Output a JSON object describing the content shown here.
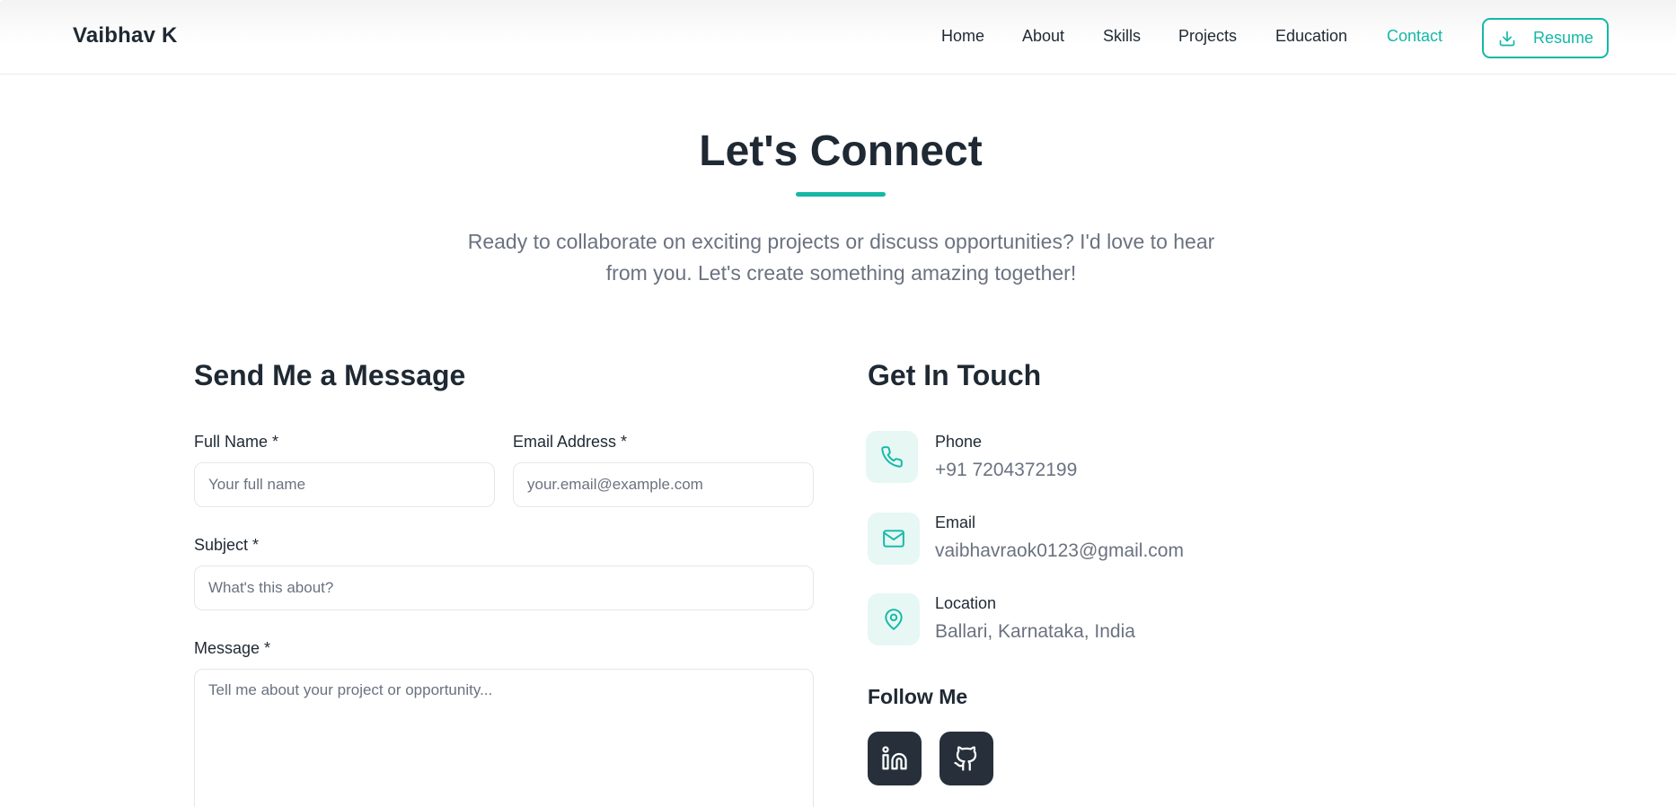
{
  "header": {
    "brand": "Vaibhav K",
    "nav": [
      {
        "label": "Home",
        "active": false
      },
      {
        "label": "About",
        "active": false
      },
      {
        "label": "Skills",
        "active": false
      },
      {
        "label": "Projects",
        "active": false
      },
      {
        "label": "Education",
        "active": false
      },
      {
        "label": "Contact",
        "active": true
      }
    ],
    "resume_label": "Resume",
    "resume_icon": "download-icon"
  },
  "hero": {
    "title": "Let's Connect",
    "subtitle": "Ready to collaborate on exciting projects or discuss opportunities? I'd love to hear from you. Let's create something amazing together!"
  },
  "form": {
    "title": "Send Me a Message",
    "full_name": {
      "label": "Full Name *",
      "placeholder": "Your full name",
      "value": ""
    },
    "email": {
      "label": "Email Address *",
      "placeholder": "your.email@example.com",
      "value": ""
    },
    "subject": {
      "label": "Subject *",
      "placeholder": "What's this about?",
      "value": ""
    },
    "message": {
      "label": "Message *",
      "placeholder": "Tell me about your project or opportunity...",
      "value": ""
    }
  },
  "contact": {
    "title": "Get In Touch",
    "items": [
      {
        "label": "Phone",
        "value": "+91 7204372199",
        "icon": "phone-icon"
      },
      {
        "label": "Email",
        "value": "vaibhavraok0123@gmail.com",
        "icon": "mail-icon"
      },
      {
        "label": "Location",
        "value": "Ballari, Karnataka, India",
        "icon": "map-pin-icon"
      }
    ],
    "follow_title": "Follow Me",
    "socials": [
      {
        "name": "linkedin-icon"
      },
      {
        "name": "github-icon"
      }
    ]
  },
  "colors": {
    "accent": "#14b8a6",
    "text_dark": "#1f2933",
    "text_muted": "#6b7280",
    "icon_bg": "#e6f7f4",
    "social_bg": "#27303a"
  }
}
